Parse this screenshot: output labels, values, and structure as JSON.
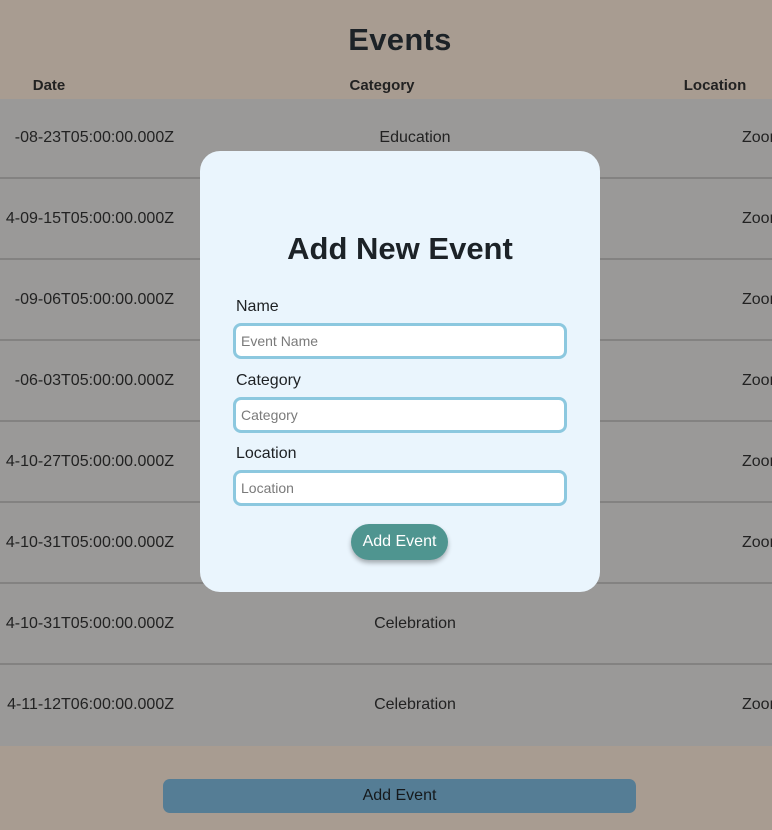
{
  "page": {
    "title": "Events"
  },
  "table": {
    "columns": [
      "Date",
      "Category",
      "Location"
    ],
    "rows": [
      {
        "date": "-08-23T05:00:00.000Z",
        "category": "Education",
        "location": "Zoom"
      },
      {
        "date": "4-09-15T05:00:00.000Z",
        "category": "",
        "location": "Zoom"
      },
      {
        "date": "-09-06T05:00:00.000Z",
        "category": "",
        "location": "Zoom"
      },
      {
        "date": "-06-03T05:00:00.000Z",
        "category": "",
        "location": "Zoom"
      },
      {
        "date": "4-10-27T05:00:00.000Z",
        "category": "",
        "location": "Zoom"
      },
      {
        "date": "4-10-31T05:00:00.000Z",
        "category": "",
        "location": "Zoom"
      },
      {
        "date": "4-10-31T05:00:00.000Z",
        "category": "Celebration",
        "location": ""
      },
      {
        "date": "4-11-12T06:00:00.000Z",
        "category": "Celebration",
        "location": "Zoom"
      }
    ]
  },
  "footer": {
    "add_label": "Add Event"
  },
  "modal": {
    "title": "Add New Event",
    "fields": [
      {
        "label": "Name",
        "placeholder": "Event Name",
        "value": ""
      },
      {
        "label": "Category",
        "placeholder": "Category",
        "value": ""
      },
      {
        "label": "Location",
        "placeholder": "Location",
        "value": ""
      }
    ],
    "submit_label": "Add Event"
  },
  "colors": {
    "backdrop": "#a89c91",
    "modal_background": "#eaf5fd",
    "input_border": "#8cc8df",
    "submit_button": "#4f9590",
    "footer_button": "#557d95"
  }
}
